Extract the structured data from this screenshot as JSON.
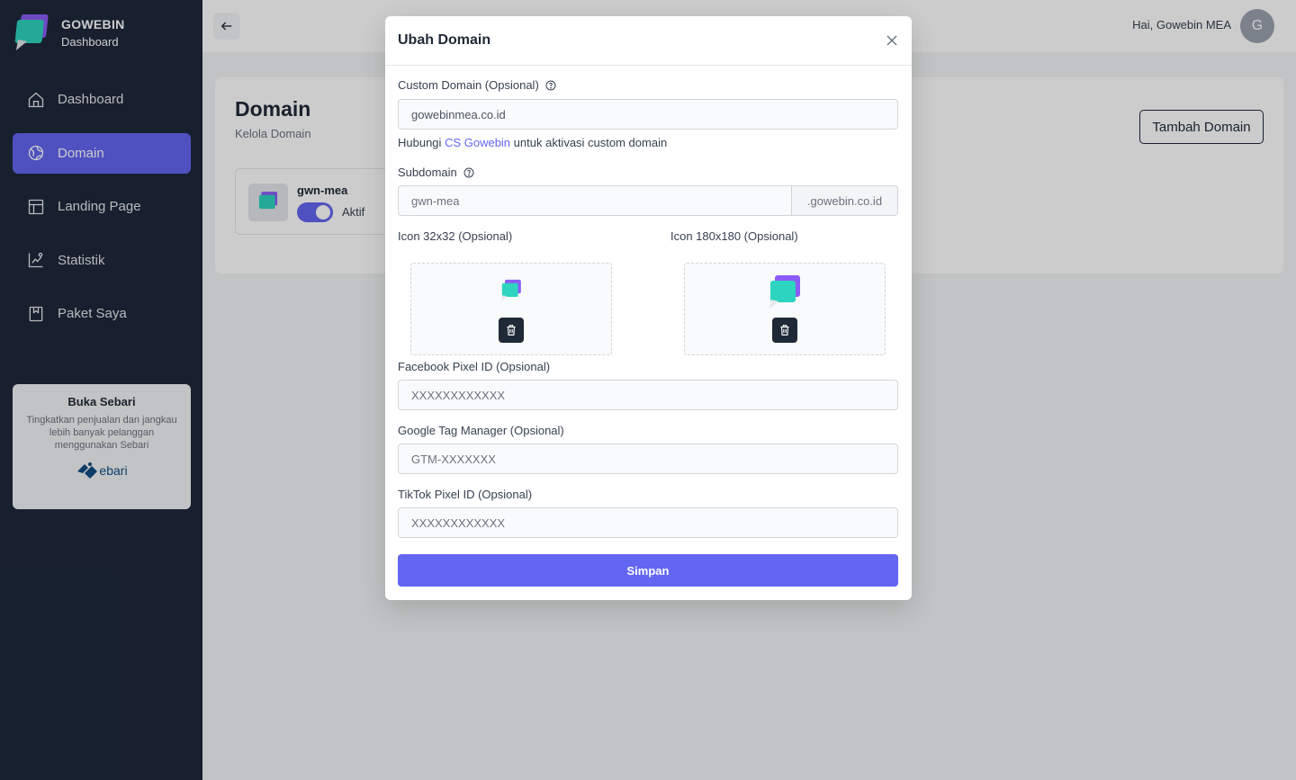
{
  "brand": {
    "name": "GOWEBIN",
    "subtitle": "Dashboard"
  },
  "sidebar": {
    "items": [
      {
        "label": "Dashboard",
        "icon": "home-icon",
        "active": false
      },
      {
        "label": "Domain",
        "icon": "globe-icon",
        "active": true
      },
      {
        "label": "Landing Page",
        "icon": "layout-icon",
        "active": false
      },
      {
        "label": "Statistik",
        "icon": "chart-icon",
        "active": false
      },
      {
        "label": "Paket Saya",
        "icon": "package-icon",
        "active": false
      }
    ],
    "promo": {
      "title": "Buka Sebari",
      "text": "Tingkatkan penjualan dan jangkau lebih banyak pelanggan menggunakan Sebari",
      "logo_text": "ebari"
    }
  },
  "topbar": {
    "greeting": "Hai, Gowebin MEA",
    "avatar_initial": "G"
  },
  "page": {
    "title": "Domain",
    "subtitle": "Kelola Domain",
    "add_button": "Tambah Domain",
    "domain_item": {
      "name": "gwn-mea",
      "status": "Aktif",
      "enabled": true
    }
  },
  "modal": {
    "title": "Ubah Domain",
    "custom_domain": {
      "label": "Custom Domain (Opsional)",
      "value": "gowebinmea.co.id",
      "hint_prefix": "Hubungi",
      "hint_link": "CS Gowebin",
      "hint_suffix": "untuk aktivasi custom domain"
    },
    "subdomain": {
      "label": "Subdomain",
      "value": "gwn-mea",
      "suffix": ".gowebin.co.id"
    },
    "icon_small": {
      "label": "Icon 32x32 (Opsional)"
    },
    "icon_large": {
      "label": "Icon 180x180 (Opsional)"
    },
    "facebook_pixel": {
      "label": "Facebook Pixel ID (Opsional)",
      "placeholder": "XXXXXXXXXXXX"
    },
    "google_tag": {
      "label": "Google Tag Manager (Opsional)",
      "placeholder": "GTM-XXXXXXX"
    },
    "tiktok_pixel": {
      "label": "TikTok Pixel ID (Opsional)",
      "placeholder": "XXXXXXXXXXXX"
    },
    "save_button": "Simpan"
  },
  "colors": {
    "sidebar_bg": "#1e293b",
    "accent": "#6366f1",
    "logo_teal": "#2dd4bf",
    "logo_purple": "#8b5cf6"
  }
}
